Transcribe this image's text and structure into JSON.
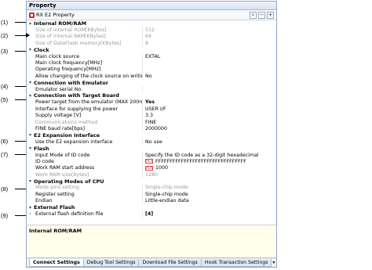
{
  "window": {
    "title": "Property"
  },
  "toolbar": {
    "target_label": "RX E2 Property",
    "find_glyph": "⌕",
    "collapse_glyph": "−",
    "expand_glyph": "+"
  },
  "callouts": [
    "(1)",
    "(2)",
    "(3)",
    "(4)",
    "(5)",
    "(6)",
    "(7)",
    "(8)",
    "(9)"
  ],
  "categories": {
    "internal_rom_ram": {
      "label": "Internal ROM/RAM",
      "rows": [
        {
          "name": "Size of internal ROM[KBytes]",
          "value": "512"
        },
        {
          "name": "Size of internal RAM[KBytes]",
          "value": "64"
        },
        {
          "name": "Size of DataFlash memory[KBytes]",
          "value": "8"
        }
      ]
    },
    "clock": {
      "label": "Clock",
      "rows": [
        {
          "name": "Main clock source",
          "value": "EXTAL"
        },
        {
          "name": "Main clock frequency[MHz]",
          "value": ""
        },
        {
          "name": "Operating frequency[MHz]",
          "value": ""
        },
        {
          "name": "Allow changing of the clock source on writing inte",
          "value": "No"
        }
      ]
    },
    "connection_emulator": {
      "label": "Connection with Emulator",
      "rows": [
        {
          "name": "Emulator serial No.",
          "value": ""
        }
      ]
    },
    "connection_target": {
      "label": "Connection with Target Board",
      "rows": [
        {
          "name": "Power target from the emulator (MAX 200mA)",
          "value": "Yes"
        },
        {
          "name": "Interface for supplying the power",
          "value": "USER I/F"
        },
        {
          "name": "Supply voltage [V]",
          "value": "3.3"
        },
        {
          "name": "Communications method",
          "value": "FINE"
        },
        {
          "name": "FINE baud rate[bps]",
          "value": "2000000"
        }
      ]
    },
    "e2_expansion": {
      "label": "E2 Expansion Interface",
      "rows": [
        {
          "name": "Use the E2 expansion interface",
          "value": "No use"
        }
      ]
    },
    "flash": {
      "label": "Flash",
      "rows": [
        {
          "name": "Input Mode of ID code",
          "value": "Specify the ID code as a 32-digit hexadecimal"
        },
        {
          "name": "ID code",
          "value": "FFFFFFFFFFFFFFFFFFFFFFFFFFFFFFFF",
          "badge": "HEX"
        },
        {
          "name": "Work RAM start address",
          "value": "1000",
          "badge": "HEX"
        },
        {
          "name": "Work RAM size[bytes]",
          "value": "1280"
        }
      ]
    },
    "operating_modes": {
      "label": "Operating Modes of CPU",
      "rows": [
        {
          "name": "Mode pins setting",
          "value": "Single-chip mode"
        },
        {
          "name": "Register setting",
          "value": "Single-chip mode"
        },
        {
          "name": "Endian",
          "value": "Little-endian data"
        }
      ]
    },
    "external_flash": {
      "label": "External Flash",
      "rows": [
        {
          "name": "External flash definition file",
          "value": "[4]"
        }
      ]
    }
  },
  "description": {
    "title": "Internal ROM/RAM"
  },
  "tabs": [
    "Connect Settings",
    "Debug Tool Settings",
    "Download File Settings",
    "Hook Transaction Settings"
  ],
  "tabs_more": "▾"
}
